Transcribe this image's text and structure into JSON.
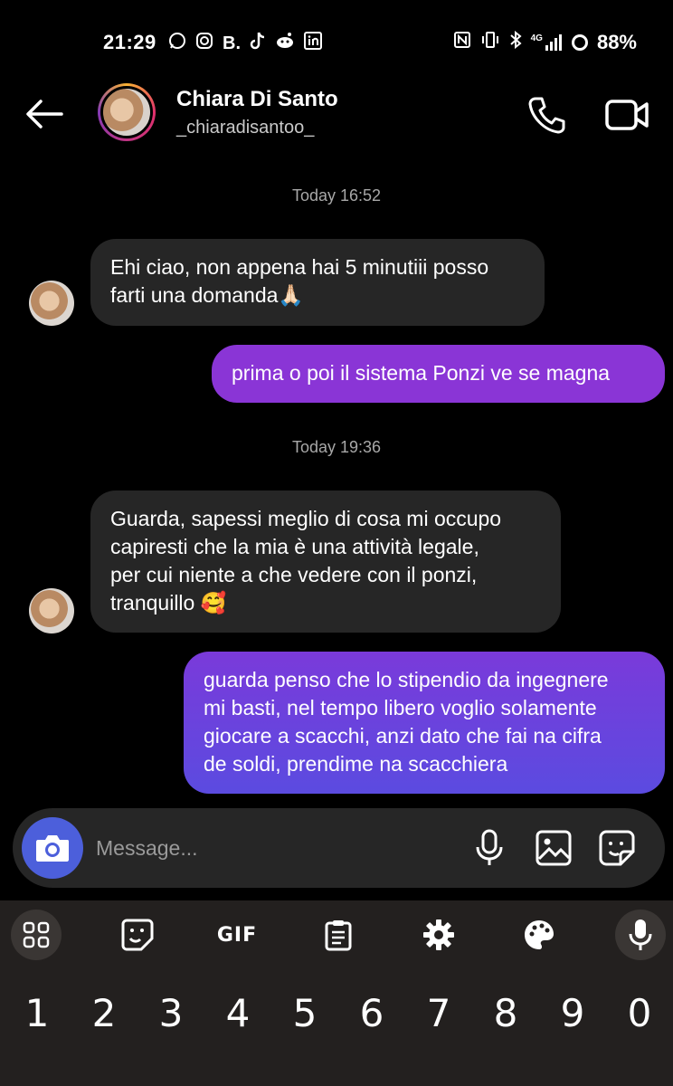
{
  "status_bar": {
    "time": "21:29",
    "left_icons": [
      "whatsapp-icon",
      "instagram-icon",
      "booking-icon",
      "tiktok-icon",
      "reddit-icon",
      "linkedin-icon"
    ],
    "right_icons": [
      "nfc-icon",
      "vibrate-icon",
      "bluetooth-icon",
      "4g-signal-icon",
      "battery-icon"
    ],
    "network": "4G",
    "battery": "88%"
  },
  "header": {
    "contact_name": "Chiara Di Santo",
    "contact_handle": "_chiaradisantoo_"
  },
  "messages": [
    {
      "type": "timestamp",
      "text": "Today 16:52"
    },
    {
      "type": "incoming",
      "lines": [
        "Ehi ciao, non appena hai 5 minutiii posso",
        "farti una domanda🙏🏻"
      ]
    },
    {
      "type": "outgoing",
      "lines": [
        "prima o poi il sistema Ponzi ve se magna"
      ]
    },
    {
      "type": "timestamp",
      "text": "Today 19:36"
    },
    {
      "type": "incoming",
      "lines": [
        "Guarda, sapessi meglio di cosa mi occupo",
        "capiresti che la mia è una attività legale,",
        "per cui niente a che vedere con il ponzi,",
        "tranquillo 🥰"
      ]
    },
    {
      "type": "outgoing",
      "lines": [
        "guarda penso che lo stipendio da ingegnere",
        "mi basti, nel tempo libero voglio solamente",
        "giocare a scacchi, anzi dato che fai na cifra",
        "de soldi, prendime na scacchiera"
      ]
    }
  ],
  "composer": {
    "placeholder": "Message..."
  },
  "keyboard": {
    "gif_label": "GIF",
    "numbers": [
      "1",
      "2",
      "3",
      "4",
      "5",
      "6",
      "7",
      "8",
      "9",
      "0"
    ]
  },
  "colors": {
    "background": "#000000",
    "incoming_bubble": "#262626",
    "outgoing_bubble_1": "#8a35d6",
    "outgoing_bubble_2": "#5b4be0",
    "camera_button": "#4c5fdb",
    "keyboard": "#23201f"
  }
}
